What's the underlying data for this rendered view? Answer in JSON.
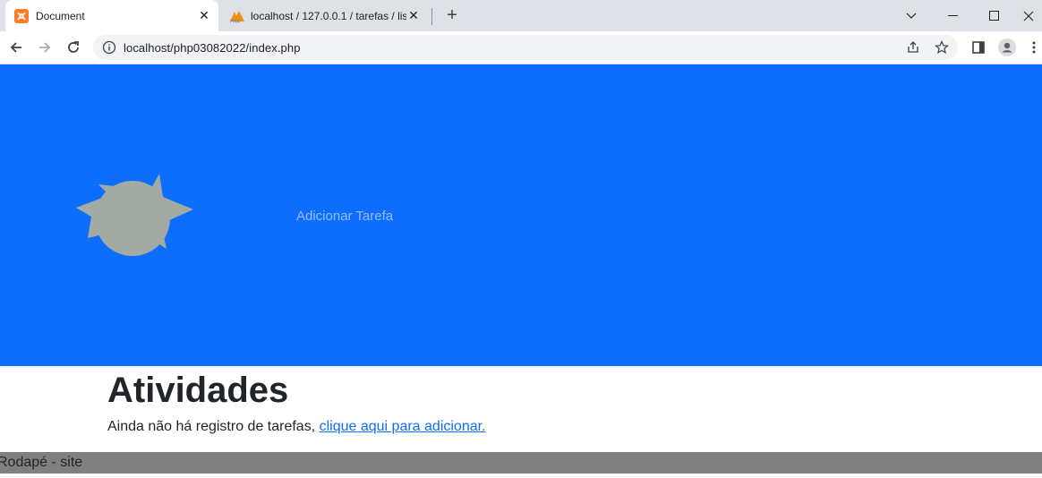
{
  "browser": {
    "tabs": [
      {
        "title": "Document",
        "icon": "xampp-icon",
        "active": true
      },
      {
        "title": "localhost / 127.0.0.1 / tarefas / lis",
        "icon": "phpmyadmin-icon",
        "active": false
      }
    ],
    "address": "localhost/php03082022/index.php"
  },
  "page": {
    "nav_link": "Adicionar Tarefa",
    "heading": "Atividades",
    "empty_message": "Ainda não há registro de tarefas,",
    "empty_link": "clique aqui para adicionar.",
    "footer": "Rodapé - site"
  },
  "colors": {
    "hero": "#0d6efd",
    "footer": "#808080",
    "logo": "#a3aaa4"
  }
}
